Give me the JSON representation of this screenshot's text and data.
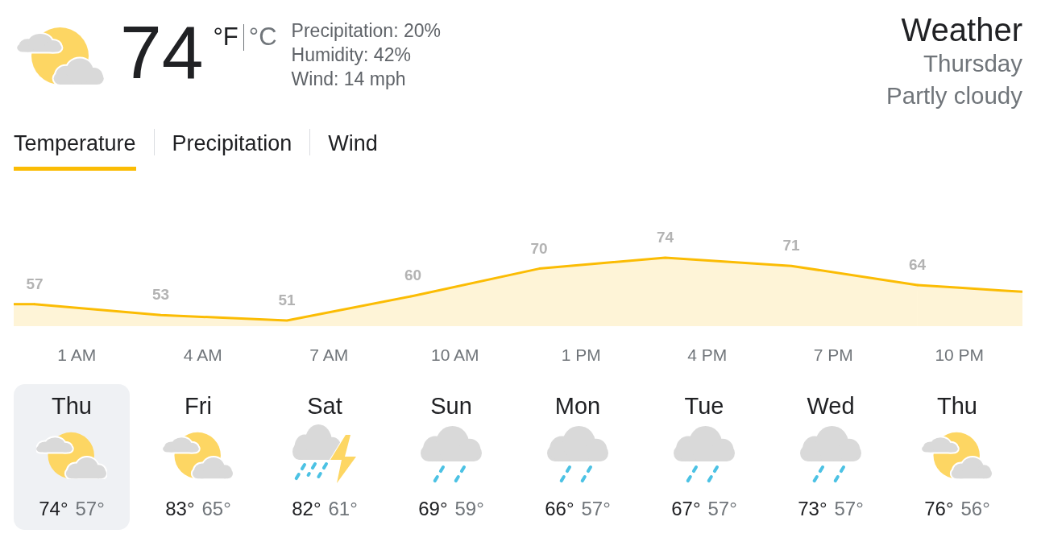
{
  "current": {
    "temperature": "74",
    "units": [
      {
        "label": "°F",
        "selected": true
      },
      {
        "label": "°C",
        "selected": false
      }
    ],
    "details": [
      "Precipitation: 20%",
      "Humidity: 42%",
      "Wind: 14 mph"
    ]
  },
  "header": {
    "title": "Weather",
    "day": "Thursday",
    "condition": "Partly cloudy"
  },
  "tabs": [
    {
      "label": "Temperature",
      "selected": true
    },
    {
      "label": "Precipitation",
      "selected": false
    },
    {
      "label": "Wind",
      "selected": false
    }
  ],
  "chart": {
    "chart_data": {
      "type": "area",
      "categories": [
        null,
        "1 AM",
        null,
        null,
        "4 AM",
        null,
        null,
        "7 AM",
        null,
        null,
        "10 AM",
        null,
        null,
        "1 PM",
        null,
        null,
        "4 PM",
        null,
        null,
        "7 PM",
        null,
        null,
        "10 PM",
        null
      ],
      "series": [
        {
          "color": "#fbbc04",
          "values": [
            57,
            null,
            null,
            53,
            null,
            null,
            51,
            null,
            null,
            60,
            null,
            null,
            70,
            null,
            null,
            74,
            null,
            null,
            71,
            null,
            null,
            64,
            null,
            null
          ]
        }
      ],
      "data_labels": true
    }
  },
  "days": [
    {
      "name": "Thu",
      "kind": "partly-cloudy",
      "high": "74°",
      "low": "57°",
      "selected": true
    },
    {
      "name": "Fri",
      "kind": "partly-cloudy",
      "high": "83°",
      "low": "65°",
      "selected": false
    },
    {
      "name": "Sat",
      "kind": "thunderstorm",
      "high": "82°",
      "low": "61°",
      "selected": false
    },
    {
      "name": "Sun",
      "kind": "rain",
      "high": "69°",
      "low": "59°",
      "selected": false
    },
    {
      "name": "Mon",
      "kind": "rain",
      "high": "66°",
      "low": "57°",
      "selected": false
    },
    {
      "name": "Tue",
      "kind": "rain",
      "high": "67°",
      "low": "57°",
      "selected": false
    },
    {
      "name": "Wed",
      "kind": "rain",
      "high": "73°",
      "low": "57°",
      "selected": false
    },
    {
      "name": "Thu",
      "kind": "partly-cloudy",
      "high": "76°",
      "low": "56°",
      "selected": false
    }
  ]
}
